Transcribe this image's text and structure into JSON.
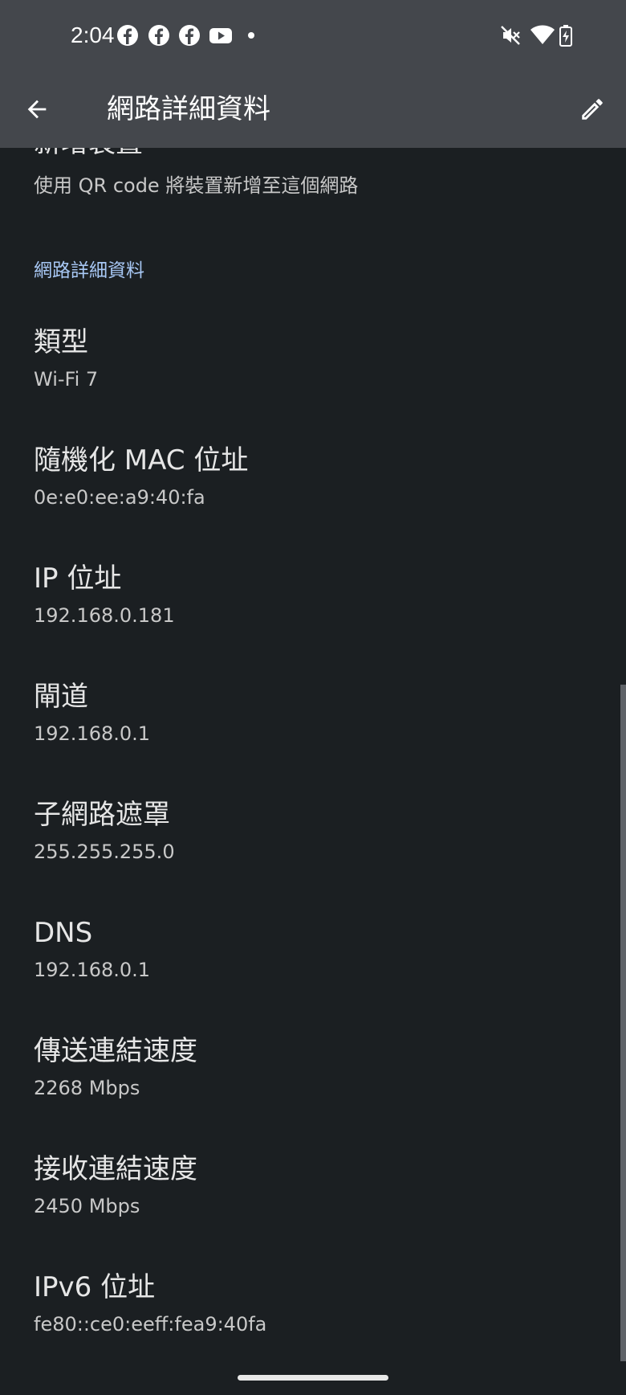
{
  "status_bar": {
    "time": "2:04",
    "notification_icons": [
      "facebook-icon",
      "facebook-icon",
      "facebook-icon",
      "youtube-icon",
      "dot-icon"
    ],
    "system_icons": [
      "mute-icon",
      "wifi-icon",
      "battery-charging-icon"
    ]
  },
  "app_bar": {
    "title": "網路詳細資料",
    "back_icon": "back-arrow-icon",
    "edit_icon": "pencil-icon"
  },
  "add_device": {
    "title": "新增裝置",
    "subtitle": "使用 QR code 將裝置新增至這個網路"
  },
  "section": {
    "header": "網路詳細資料"
  },
  "details": [
    {
      "title": "類型",
      "value": "Wi-Fi 7"
    },
    {
      "title": "隨機化 MAC 位址",
      "value": "0e:e0:ee:a9:40:fa"
    },
    {
      "title": "IP 位址",
      "value": "192.168.0.181"
    },
    {
      "title": "閘道",
      "value": "192.168.0.1"
    },
    {
      "title": "子網路遮罩",
      "value": "255.255.255.0"
    },
    {
      "title": "DNS",
      "value": "192.168.0.1"
    },
    {
      "title": "傳送連結速度",
      "value": "2268 Mbps"
    },
    {
      "title": "接收連結速度",
      "value": "2450 Mbps"
    },
    {
      "title": "IPv6 位址",
      "value": "fe80::ce0:eeff:fea9:40fa"
    }
  ],
  "colors": {
    "background": "#1b1f22",
    "app_bar": "#44474c",
    "section_header": "#a8c8f5"
  }
}
